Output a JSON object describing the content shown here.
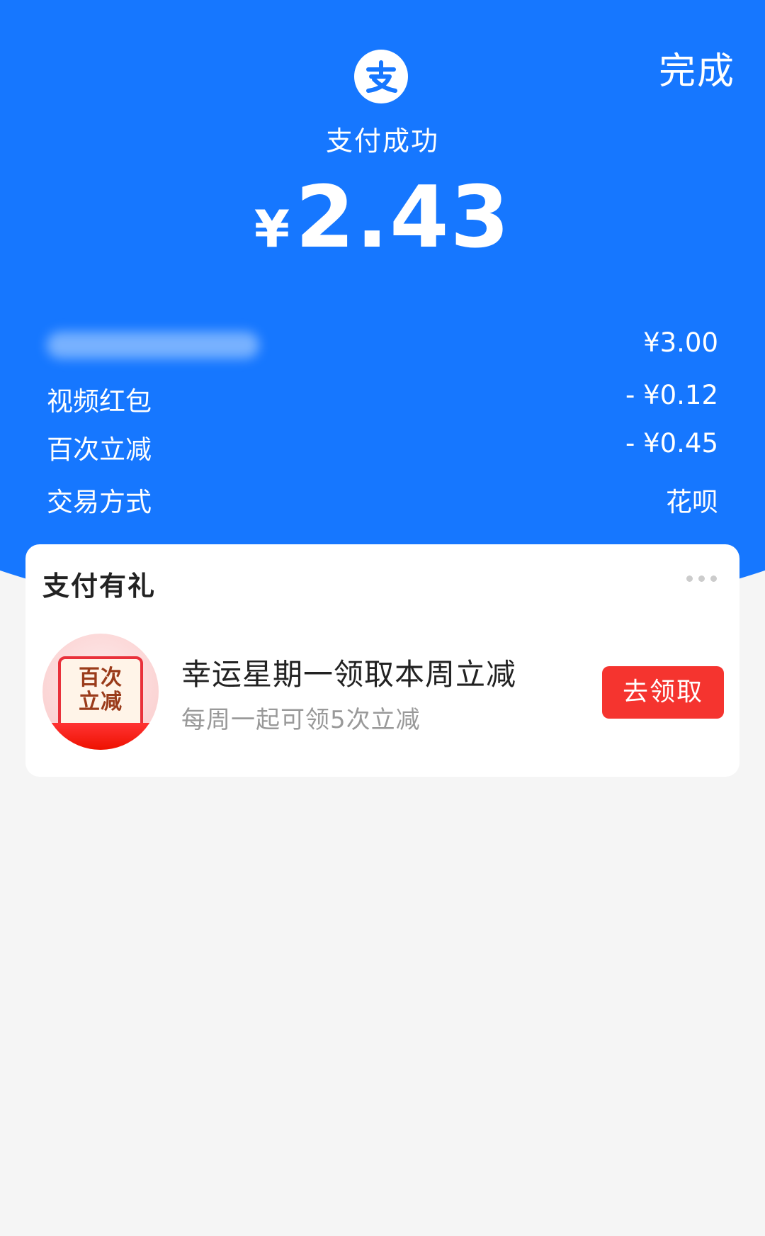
{
  "header": {
    "done_label": "完成",
    "logo_icon": "alipay-logo-icon",
    "status_title": "支付成功",
    "amount": {
      "currency": "¥",
      "value": "2.43"
    },
    "colors": {
      "background": "#1677ff"
    }
  },
  "details": [
    {
      "label": "",
      "value": "¥3.00"
    },
    {
      "label": "视频红包",
      "value": "- ¥0.12"
    },
    {
      "label": "百次立减",
      "value": "- ¥0.45"
    },
    {
      "label": "交易方式",
      "value": "花呗"
    }
  ],
  "card": {
    "title": "支付有礼",
    "more_icon": "more-dots-icon",
    "promo": {
      "image_text_line1": "百次",
      "image_text_line2": "立减",
      "title": "幸运星期一领取本周立减",
      "subtitle": "每周一起可领5次立减",
      "button_label": "去领取",
      "button_color": "#f5342f"
    }
  }
}
